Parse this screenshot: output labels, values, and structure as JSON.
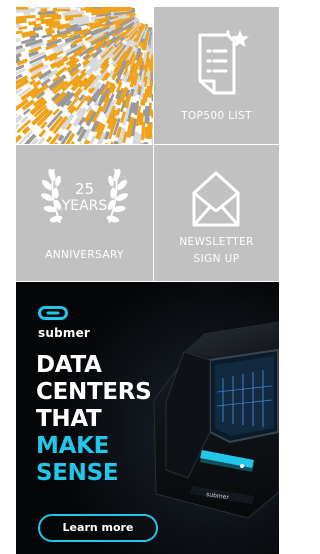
{
  "tiles": {
    "top500": {
      "label": "TOP500 LIST",
      "icon": "document-star-icon"
    },
    "anniversary": {
      "number": "25",
      "years": "YEARS",
      "label": "ANNIVERSARY",
      "icon": "laurel-wreath-icon"
    },
    "newsletter": {
      "line1": "NEWSLETTER",
      "line2": "SIGN UP",
      "icon": "envelope-icon"
    }
  },
  "ad": {
    "brand": "submer",
    "headline_white": [
      "DATA",
      "CENTERS",
      "THAT"
    ],
    "headline_cyan": [
      "MAKE",
      "SENSE"
    ],
    "cta_label": "Learn more",
    "accent_color": "#22c6e8"
  },
  "colors": {
    "tile_gray": "#c1c1c1",
    "art_orange": "#f0a21a",
    "art_gray": "#9a9a9a",
    "ad_background": "#050608"
  }
}
